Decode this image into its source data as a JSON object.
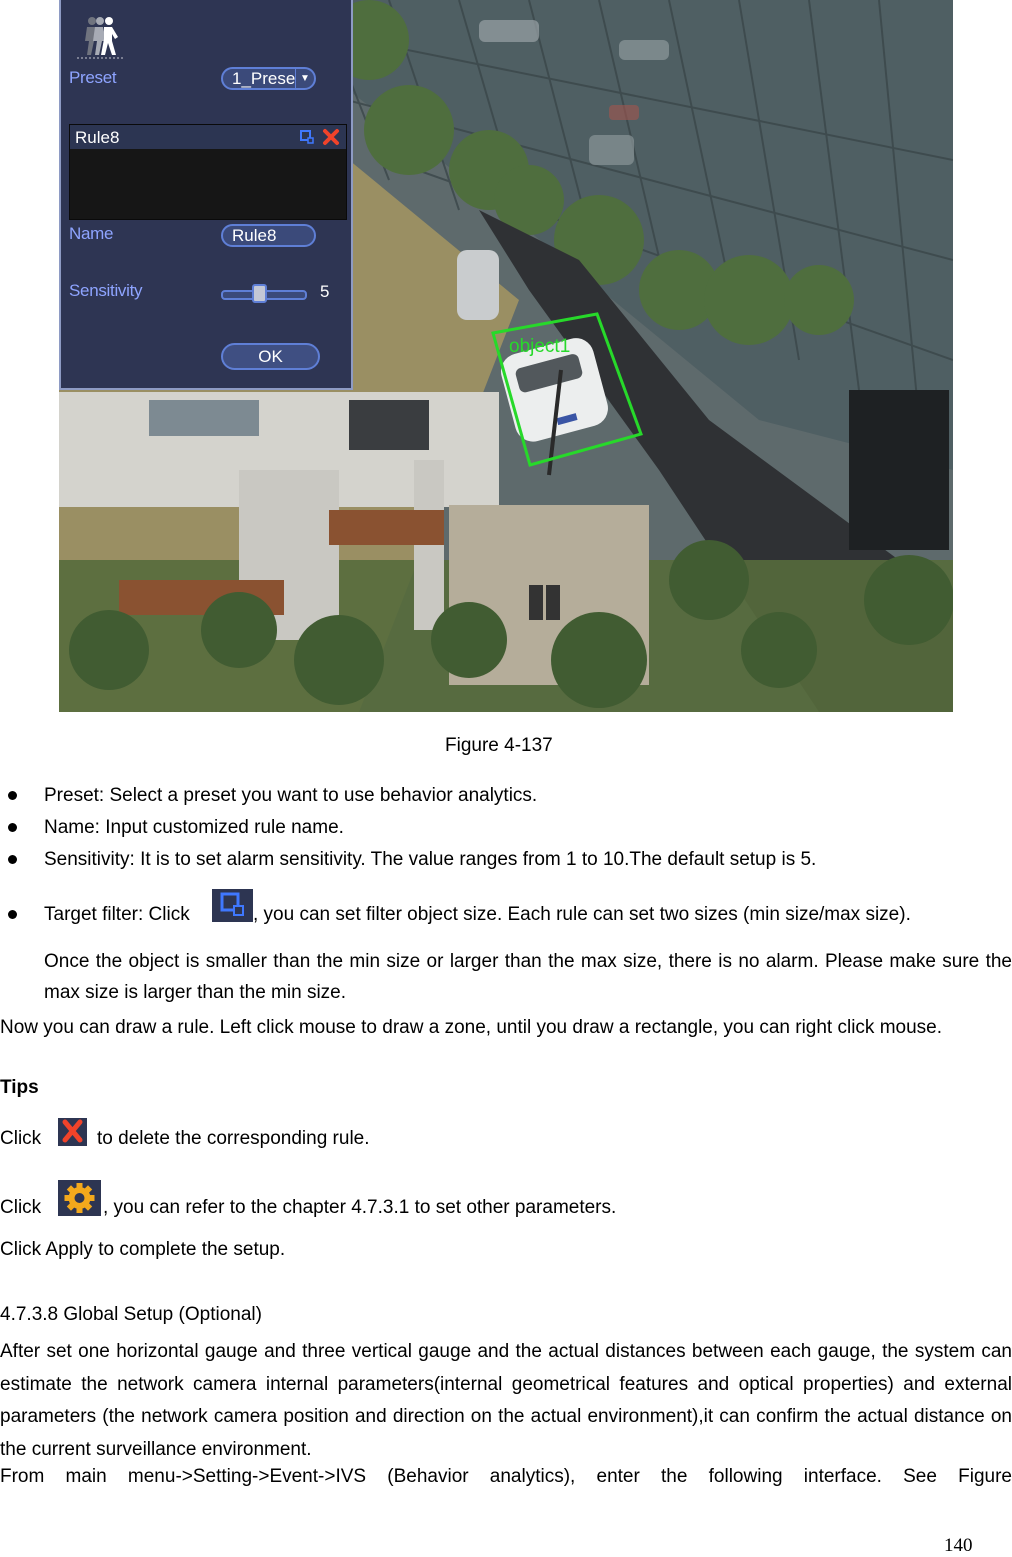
{
  "figure": {
    "caption": "Figure 4-137",
    "scene_description": "surveillance camera view of building courtyard with parked car",
    "overlay": {
      "object_label": "object1",
      "box_color": "#27d92a"
    },
    "panel": {
      "icon": "walking-person-icon",
      "preset_label": "Preset",
      "preset_value": "1_Prese",
      "rule_title": "Rule8",
      "rule_icons": [
        "target-filter-icon",
        "delete-icon"
      ],
      "name_label": "Name",
      "name_value": "Rule8",
      "sensitivity_label": "Sensitivity",
      "sensitivity_value": "5",
      "sensitivity_range": [
        1,
        10
      ],
      "ok_label": "OK",
      "colors": {
        "panel_bg": "#2e3553",
        "label": "#8ea4ff",
        "accent": "#5f7fd6"
      }
    }
  },
  "bullets": [
    {
      "text": "Preset: Select a preset you want to use behavior analytics."
    },
    {
      "text": "Name: Input customized rule name."
    },
    {
      "text": "Sensitivity: It is to set alarm sensitivity. The value ranges from 1 to 10.The default setup is 5."
    },
    {
      "text_before_icon": "Target filter: Click",
      "icon": "target-filter-icon",
      "text_after_icon": ", you can set filter object size. Each rule can set two sizes (min size/max size).",
      "continuation": "Once the object is smaller than the min size or larger than the max size, there is no alarm. Please make sure the max size is larger than the min size."
    }
  ],
  "draw_paragraph": "Now you can draw a rule. Left click mouse to draw a zone, until you draw a rectangle, you can right click mouse.",
  "tips": {
    "heading": "Tips",
    "delete_line": {
      "before": "Click",
      "icon": "delete-icon",
      "after": "to delete the corresponding rule."
    },
    "settings_line": {
      "before": "Click",
      "icon": "gear-icon",
      "after": ", you can refer to the chapter 4.7.3.1 to set other parameters."
    },
    "apply_line": "Click Apply to complete the setup."
  },
  "section": {
    "heading": "4.7.3.8 Global Setup (Optional)",
    "paragraph1": "After set one horizontal gauge and three vertical gauge and the actual distances between each gauge, the system can estimate the network camera internal parameters(internal geometrical features and optical properties) and external parameters (the network camera position and direction on the actual environment),it can confirm the actual distance on the current surveillance environment.",
    "paragraph2": "From main menu->Setting->Event->IVS (Behavior analytics), enter the following interface. See Figure"
  },
  "page_number": "140"
}
